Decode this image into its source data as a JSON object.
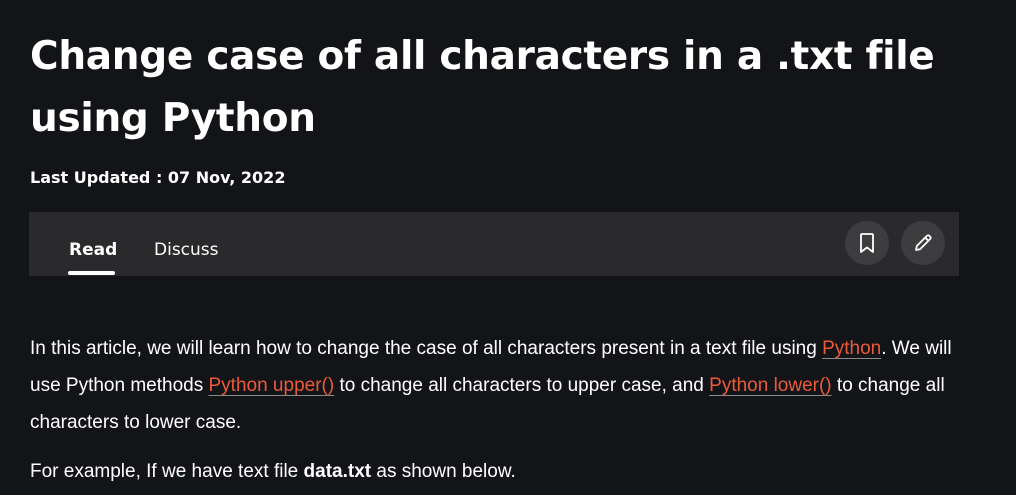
{
  "article": {
    "title": "Change case of all characters in a .txt file using Python",
    "last_updated": "Last Updated : 07 Nov, 2022"
  },
  "tabs": {
    "read": "Read",
    "discuss": "Discuss"
  },
  "actions": {
    "bookmark_icon": "bookmark-icon",
    "edit_icon": "pencil-icon"
  },
  "body": {
    "p1_start": "In this article, we will learn how to change the case of all characters present in a text file using ",
    "link_python": "Python",
    "p1_mid1": ". We will use Python methods ",
    "link_upper": "Python upper()",
    "p1_mid2": " to change all characters to upper case, and ",
    "link_lower": "Python lower()",
    "p1_end": " to change all characters to lower case.",
    "p2_start": "For example, If we have text file ",
    "p2_file": "data.txt",
    "p2_end": " as shown below."
  },
  "colors": {
    "background": "#131417",
    "tabbar": "#2a2a2c",
    "link": "#ec5a3a"
  }
}
